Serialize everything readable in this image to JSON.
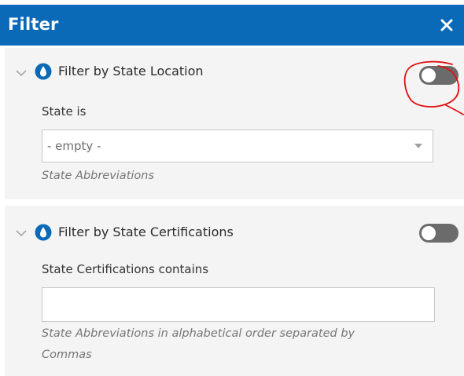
{
  "header": {
    "title": "Filter",
    "close_icon": "close-icon",
    "background_color": "#0a6ab8"
  },
  "filters": [
    {
      "title": "Filter by State Location",
      "icon": "droplet-icon",
      "expand_icon": "chevron-down-icon",
      "enabled": false,
      "field_label": "State is",
      "control": "select",
      "value": "- empty -",
      "hint": "State Abbreviations"
    },
    {
      "title": "Filter by State Certifications",
      "icon": "droplet-icon",
      "expand_icon": "chevron-down-icon",
      "enabled": false,
      "field_label": "State Certifications contains",
      "control": "text",
      "value": "",
      "hint_line1": "State Abbreviations in alphabetical order separated by",
      "hint_line2": "Commas"
    }
  ],
  "colors": {
    "accent": "#0a6ab8",
    "toggle_off": "#6b6b6b",
    "annotation": "#e01010"
  }
}
